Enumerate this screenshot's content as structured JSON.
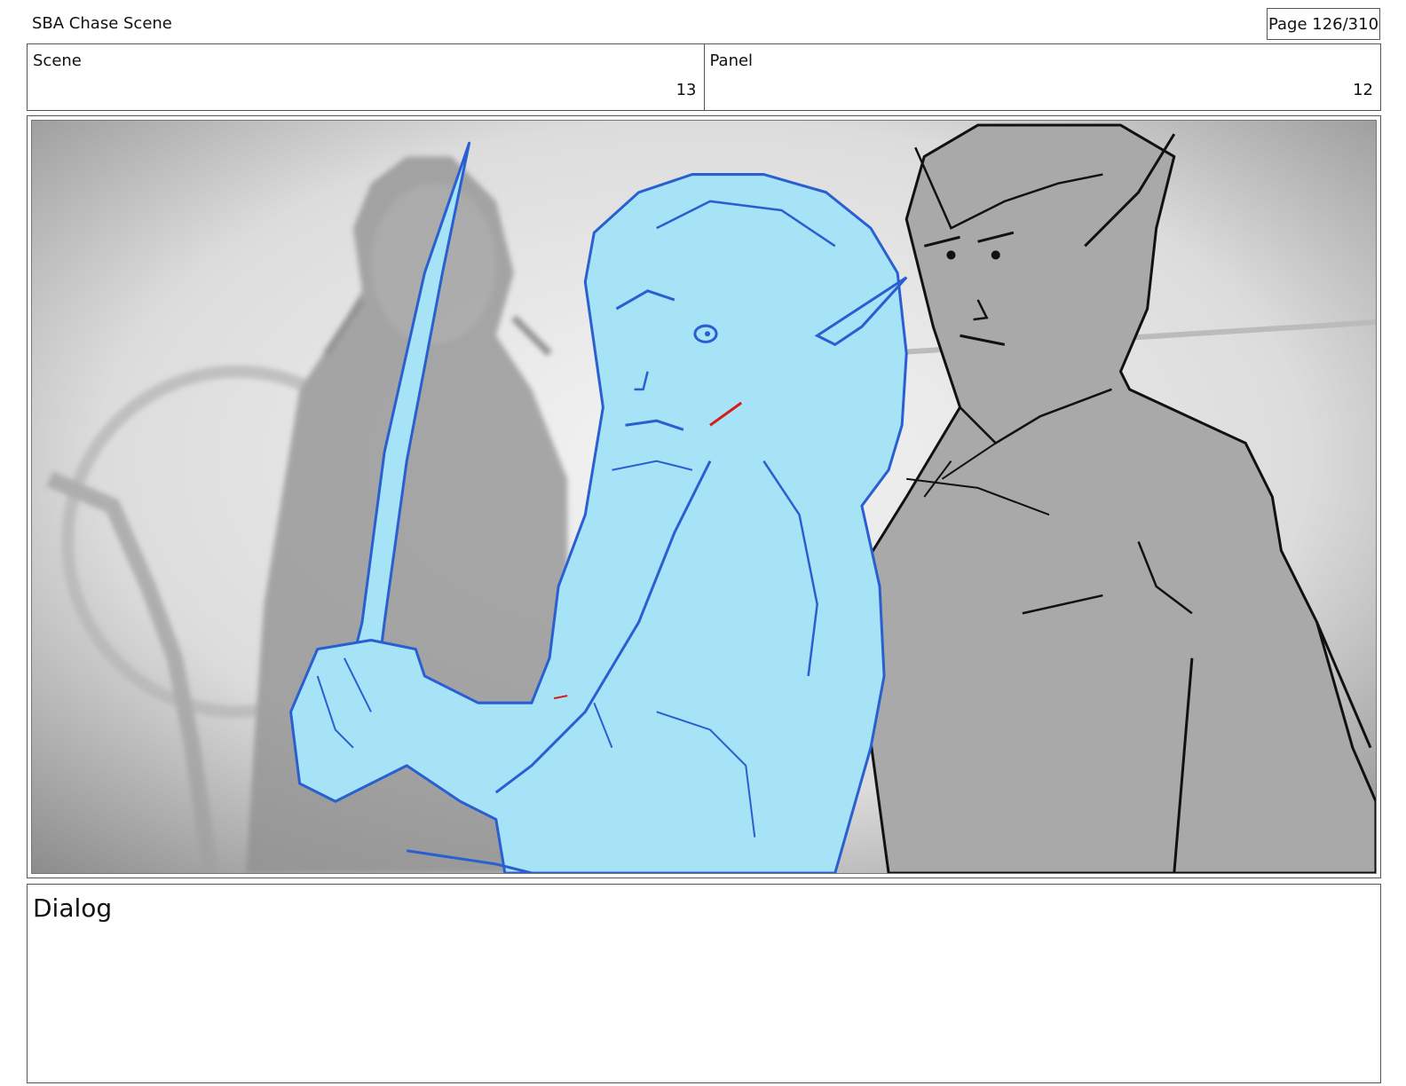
{
  "header": {
    "title": "SBA Chase Scene",
    "page": "Page 126/310"
  },
  "info": {
    "scene_label": "Scene",
    "scene_value": "13",
    "panel_label": "Panel",
    "panel_value": "12"
  },
  "dialog": {
    "label": "Dialog"
  },
  "colors": {
    "foreground_character_fill": "#a6e3f7",
    "foreground_character_line": "#2a5fd1",
    "background_character_fill": "#a9a9a9",
    "accent_red": "#d81b1b"
  }
}
